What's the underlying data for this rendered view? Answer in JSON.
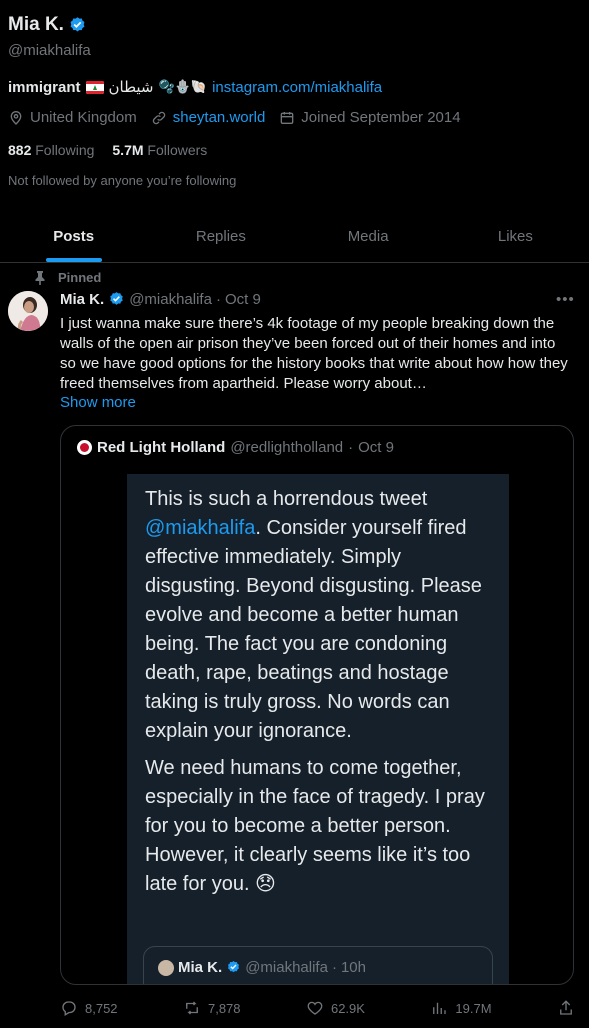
{
  "profile": {
    "display_name": "Mia K.",
    "handle": "@miakhalifa",
    "bio_word": "immigrant",
    "bio_arabic": "شيطان",
    "bio_emojis": "🫧🪬🐚",
    "bio_link": "instagram.com/miakhalifa",
    "location": "United Kingdom",
    "website": "sheytan.world",
    "joined": "Joined September 2014",
    "following_count": "882",
    "following_label": "Following",
    "followers_count": "5.7M",
    "followers_label": "Followers",
    "not_followed": "Not followed by anyone you’re following"
  },
  "tabs": [
    {
      "label": "Posts",
      "active": true
    },
    {
      "label": "Replies",
      "active": false
    },
    {
      "label": "Media",
      "active": false
    },
    {
      "label": "Likes",
      "active": false
    }
  ],
  "post": {
    "pinned_label": "Pinned",
    "author": "Mia K.",
    "handle": "@miakhalifa",
    "separator": "·",
    "date": "Oct 9",
    "text": "I just wanna make sure there’s 4k footage of my people breaking down the walls of the open air prison they’ve been forced out of their homes and into so we have good options for the history books that write about how how they freed themselves from apartheid. Please worry about…",
    "show_more": "Show more",
    "quote": {
      "author": "Red Light Holland",
      "handle": "@redlightholland",
      "separator": "·",
      "date": "Oct 9",
      "image_text_p1_prefix": "This is such a horrendous tweet ",
      "image_text_mention": "@miakhalifa",
      "image_text_p1_suffix": ". Consider yourself fired effective immediately. Simply disgusting. Beyond disgusting. Please evolve and become a better human being. The fact you are condoning death, rape, beatings and hostage taking is truly gross. No words can explain your ignorance.",
      "image_text_p2": "We need humans to come together, especially in the face of tragedy. I pray for you to become a better person. However, it clearly seems like it’s too late for you. 😞",
      "inner_author": "Mia K.",
      "inner_handle": "@miakhalifa",
      "inner_separator": "·",
      "inner_date": "10h"
    },
    "stats": {
      "replies": "8,752",
      "reposts": "7,878",
      "likes": "62.9K",
      "views": "19.7M"
    }
  },
  "colors": {
    "background": "#000000",
    "text": "#e7e9ea",
    "muted": "#71767b",
    "accent": "#1d9bf0",
    "border": "#2f3336"
  }
}
